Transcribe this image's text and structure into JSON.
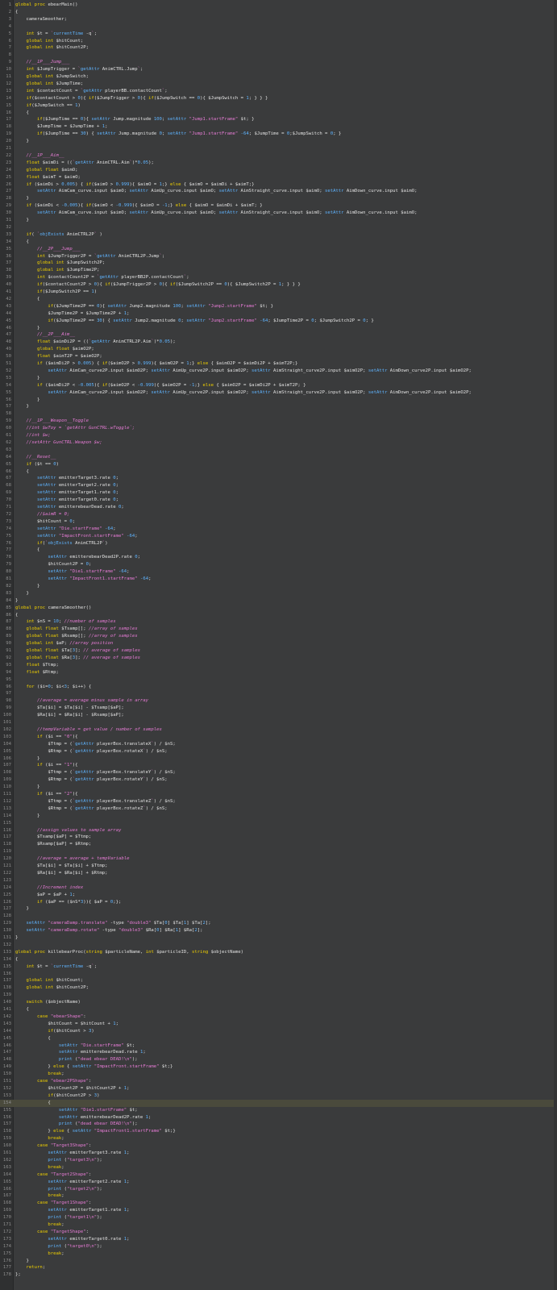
{
  "editor": {
    "colors": {
      "background": "#3a3b3c",
      "gutter": "#2f3031",
      "keyword": "#f0d000",
      "type": "#5fb4ff",
      "string": "#e57bd4",
      "comment": "#e57bd4",
      "number": "#5fb4ff",
      "text": "#e0e0e0"
    },
    "highlighted_line": 154,
    "lines": [
      "global proc ebearMain()",
      "{",
      "    cameraSmoother;",
      "",
      "    int $t = `currentTime -q`;",
      "    global int $hitCount;",
      "    global int $hitCount2P;",
      "",
      "    //__1P___Jump___",
      "    int $JumpTrigger = `getAttr AnimCTRL.Jump`;",
      "    global int $JumpSwitch;",
      "    global int $JumpTime;",
      "    int $contactCount = `getAttr playerBB.contactCount`;",
      "    if($contactCount > 0){ if($JumpTrigger > 0){ if($JumpSwitch == 0){ $JumpSwitch = 1; } } }",
      "    if($JumpSwitch == 1)",
      "    {",
      "        if($JumpTime == 0){ setAttr Jump.magnitude 100; setAttr \"Jump1.startFrame\" $t; }",
      "        $JumpTime = $JumpTime + 1;",
      "        if($JumpTime == 30) { setAttr Jump.magnitude 0; setAttr \"Jump1.startFrame\" -64; $JumpTime = 0;$JumpSwitch = 0; }",
      "    }",
      "",
      "    //__1P___Aim__",
      "    float $aimDi = ((`getAttr AnimCTRL.Aim`)*0.05);",
      "    global float $aimO;",
      "    float $aimT = $aimO;",
      "    if ($aimDi > 0.005) { if($aimO > 0.999){ $aimO = 1;} else { $aimO = $aimDi + $aimT;}",
      "        setAttr AimCam_curve.input $aimO; setAttr AimUp_curve.input $aimO; setAttr AimStraight_curve.input $aimO; setAttr AimDown_curve.input $aimO;",
      "    }",
      "    if ($aimDi < -0.005){ if($aimO < -0.999){ $aimO = -1;} else { $aimO = $aimDi + $aimT; }",
      "        setAttr AimCam_curve.input $aimO; setAttr AimUp_curve.input $aimO; setAttr AimStraight_curve.input $aimO; setAttr AimDown_curve.input $aimO;",
      "    }",
      "",
      "    if( `objExists AnimCTRL2P` )",
      "    {",
      "        //__2P___Jump___",
      "        int $JumpTrigger2P = `getAttr AnimCTRL2P.Jump`;",
      "        global int $JumpSwitch2P;",
      "        global int $JumpTime2P;",
      "        int $contactCount2P = `getAttr playerBB2P.contactCount`;",
      "        if($contactCount2P > 0){ if($JumpTrigger2P > 0){ if($JumpSwitch2P == 0){ $JumpSwitch2P = 1; } } }",
      "        if($JumpSwitch2P == 1)",
      "        {",
      "            if($JumpTime2P == 0){ setAttr Jump2.magnitude 100; setAttr \"Jump2.startFrame\" $t; }",
      "            $JumpTime2P = $JumpTime2P + 1;",
      "            if($JumpTime2P == 30) { setAttr Jump2.magnitude 0; setAttr \"Jump2.startFrame\" -64; $JumpTime2P = 0; $JumpSwitch2P = 0; }",
      "        }",
      "        //__2P___Aim__",
      "        float $aimDi2P = ((`getAttr AnimCTRL2P.Aim`)*0.05);",
      "        global float $aimO2P;",
      "        float $aimT2P = $aimO2P;",
      "        if ($aimDi2P > 0.005) { if($aimO2P > 0.999){ $aimO2P = 1;} else { $aimO2P = $aimDi2P + $aimT2P;}",
      "            setAttr AimCam_curve2P.input $aimO2P; setAttr AimUp_curve2P.input $aimO2P; setAttr AimStraight_curve2P.input $aimO2P; setAttr AimDown_curve2P.input $aimO2P;",
      "        }",
      "        if ($aimDi2P < -0.005){ if($aimO2P < -0.999){ $aimO2P = -1;} else { $aimO2P = $aimDi2P + $aimT2P; }",
      "            setAttr AimCam_curve2P.input $aimO2P; setAttr AimUp_curve2P.input $aimO2P; setAttr AimStraight_curve2P.input $aimO2P; setAttr AimDown_curve2P.input $aimO2P;",
      "        }",
      "    }",
      "",
      "    //__1P___Weapon__Toggle",
      "    //int $wToy = `getAttr GunCTRL.wToggle`;",
      "    //int $w;",
      "    //setAttr GunCTRL.Weapon $w;",
      "",
      "    //__Reset__",
      "    if ($t == 0)",
      "    {",
      "        setAttr emitterTarget3.rate 0;",
      "        setAttr emitterTarget2.rate 0;",
      "        setAttr emitterTarget1.rate 0;",
      "        setAttr emitterTarget0.rate 0;",
      "        setAttr emitterebearDead.rate 0;",
      "        //$aimR = 0;",
      "        $hitCount = 0;",
      "        setAttr \"Die.startFrame\" -64;",
      "        setAttr \"ImpactFront.startFrame\" -64;",
      "        if(`objExists AnimCTRL2P`)",
      "        {",
      "            setAttr emitterebearDead2P.rate 0;",
      "            $hitCount2P = 0;",
      "            setAttr \"Die1.startFrame\" -64;",
      "            setAttr \"ImpactFront1.startFrame\" -64;",
      "        }",
      "    }",
      "}",
      "global proc cameraSmoother()",
      "{",
      "    int $nS = 10; //number of samples",
      "    global float $Tsamp[]; //array of samples",
      "    global float $Rsamp[]; //array of samples",
      "    global int $aP; //array position",
      "    global float $Ta[3]; // average of samples",
      "    global float $Ra[3]; // average of samples",
      "    float $Ttmp;",
      "    float $Rtmp;",
      "",
      "    for ($i=0; $i<3; $i++) {",
      "",
      "        //average = average minus sample in array",
      "        $Ta[$i] = $Ta[$i] - $Tsamp[$aP];",
      "        $Ra[$i] = $Ra[$i] - $Rsamp[$aP];",
      "",
      "        //tempVariable = get value / number of samples",
      "        if ($i == \"0\"){",
      "            $Ttmp = (`getAttr playerBox.translateX`) / $nS;",
      "            $Rtmp = (`getAttr playerBox.rotateX`) / $nS;",
      "        }",
      "        if ($i == \"1\"){",
      "            $Ttmp = (`getAttr playerBox.translateY`) / $nS;",
      "            $Rtmp = (`getAttr playerBox.rotateY`) / $nS;",
      "        }",
      "        if ($i == \"2\"){",
      "            $Ttmp = (`getAttr playerBox.translateZ`) / $nS;",
      "            $Rtmp = (`getAttr playerBox.rotateZ`) / $nS;",
      "        }",
      "",
      "        //assign values to sample array",
      "        $Tsamp[$aP] = $Ttmp;",
      "        $Rsamp[$aP] = $Rtmp;",
      "",
      "        //average = average + tempVariable",
      "        $Ta[$i] = $Ta[$i] + $Ttmp;",
      "        $Ra[$i] = $Ra[$i] + $Rtmp;",
      "",
      "        //Increment index",
      "        $aP = $aP + 1;",
      "        if ($aP == ($nS*3)){ $aP = 0;};",
      "    }",
      "",
      "    setAttr \"cameraDamp.translate\" -type \"double3\" $Ta[0] $Ta[1] $Ta[2];",
      "    setAttr \"cameraDamp.rotate\" -type \"double3\" $Ra[0] $Ra[1] $Ra[2];",
      "}",
      "",
      "global proc killebearProc(string $particleName, int $particleID, string $objectName)",
      "{",
      "    int $t = `currentTime -q`;",
      "",
      "    global int $hitCount;",
      "    global int $hitCount2P;",
      "",
      "    switch ($objectName)",
      "    {",
      "        case \"ebearShape\":",
      "            $hitCount = $hitCount + 1;",
      "            if($hitCount > 3)",
      "            {",
      "                setAttr \"Die.startFrame\" $t;",
      "                setAttr emitterebearDead.rate 1;",
      "                print (\"dead ebear DEAD!\\n\");",
      "            } else { setAttr \"ImpactFront.startFrame\" $t;}",
      "            break;",
      "        case \"ebear2PShape\":",
      "            $hitCount2P = $hitCount2P + 1;",
      "            if($hitCount2P > 3)",
      "            {",
      "                setAttr \"Die1.startFrame\" $t;",
      "                setAttr emitterebearDead2P.rate 1;",
      "                print (\"dead ebear DEAD!\\n\");",
      "            } else { setAttr \"ImpactFront1.startFrame\" $t;}",
      "            break;",
      "        case \"Target3Shape\":",
      "            setAttr emitterTarget3.rate 1;",
      "            print (\"target3\\n\");",
      "            break;",
      "        case \"Target2Shape\":",
      "            setAttr emitterTarget2.rate 1;",
      "            print (\"target2\\n\");",
      "            break;",
      "        case \"Target1Shape\":",
      "            setAttr emitterTarget1.rate 1;",
      "            print (\"target1\\n\");",
      "            break;",
      "        case \"TargetShape\":",
      "            setAttr emitterTarget0.rate 1;",
      "            print (\"target0\\n\");",
      "            break;",
      "    }",
      "    return;",
      "};"
    ]
  }
}
